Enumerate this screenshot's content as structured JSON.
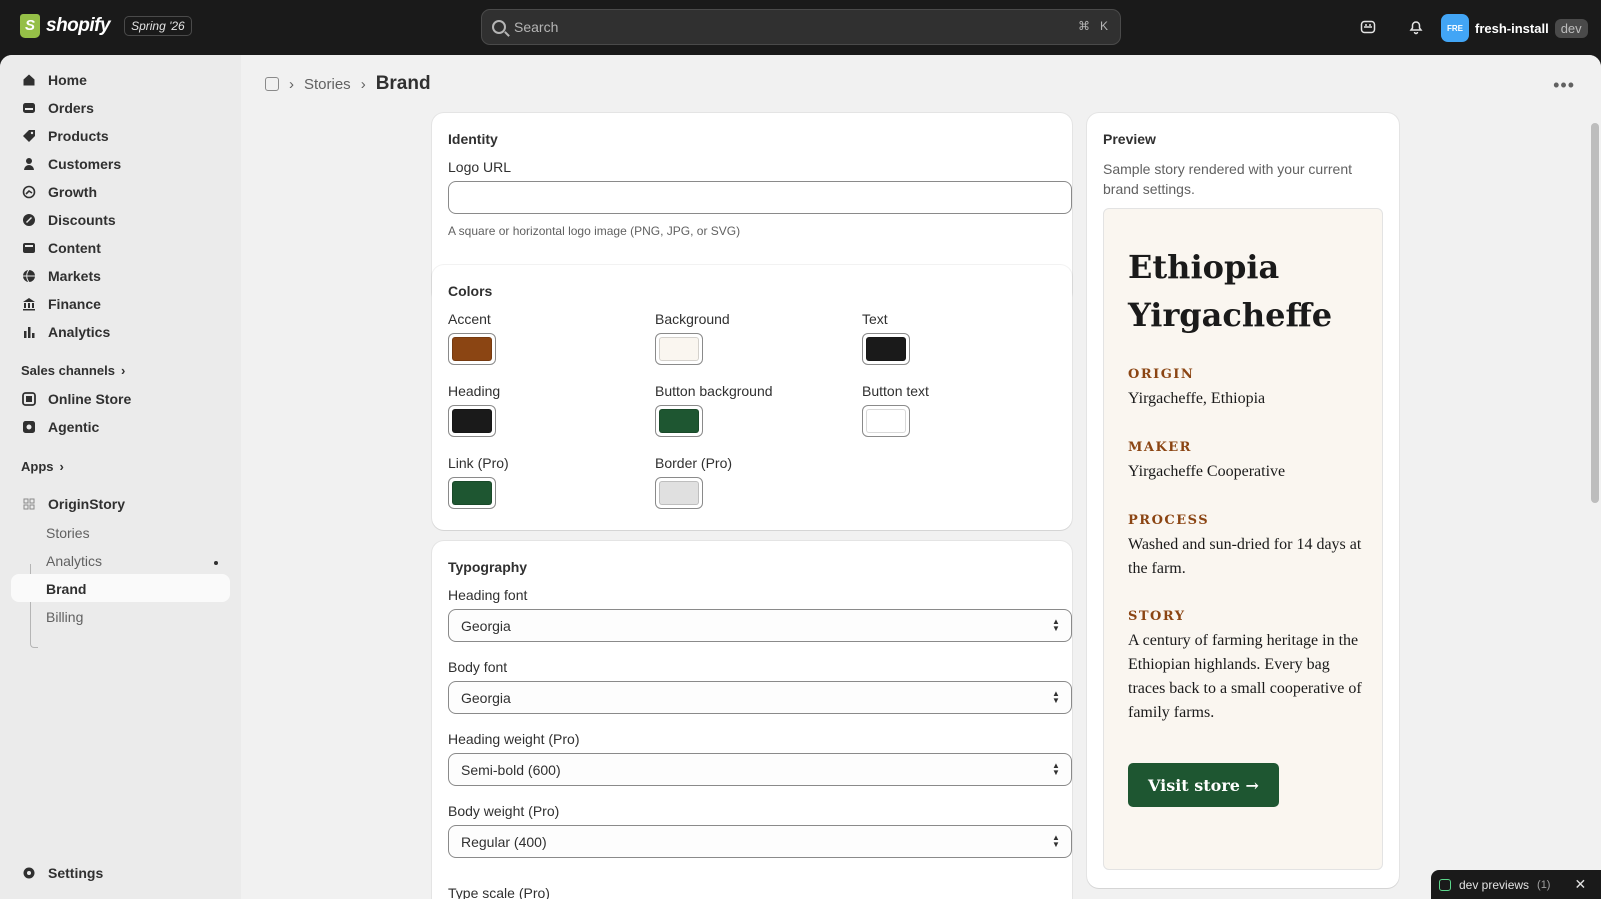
{
  "topbar": {
    "brand": "shopify",
    "edition": "Spring '26",
    "search_placeholder": "Search",
    "shortcut_cmd": "⌘",
    "shortcut_key": "K",
    "avatar_initials": "FRE",
    "store_name": "fresh-install",
    "env_badge": "dev"
  },
  "sidebar": {
    "items": [
      {
        "label": "Home",
        "icon": "home-icon"
      },
      {
        "label": "Orders",
        "icon": "orders-icon"
      },
      {
        "label": "Products",
        "icon": "tag-icon"
      },
      {
        "label": "Customers",
        "icon": "person-icon"
      },
      {
        "label": "Growth",
        "icon": "growth-icon"
      },
      {
        "label": "Discounts",
        "icon": "discount-icon"
      },
      {
        "label": "Content",
        "icon": "content-icon"
      },
      {
        "label": "Markets",
        "icon": "globe-icon"
      },
      {
        "label": "Finance",
        "icon": "bank-icon"
      },
      {
        "label": "Analytics",
        "icon": "chart-icon"
      }
    ],
    "sales_channels_label": "Sales channels",
    "channels": [
      {
        "label": "Online Store",
        "icon": "store-icon"
      },
      {
        "label": "Agentic",
        "icon": "agentic-icon"
      }
    ],
    "apps_label": "Apps",
    "app_name": "OriginStory",
    "app_subitems": [
      "Stories",
      "Analytics",
      "Brand",
      "Billing"
    ],
    "settings_label": "Settings"
  },
  "breadcrumb": {
    "parent": "Stories",
    "current": "Brand"
  },
  "identity": {
    "title": "Identity",
    "logo_label": "Logo URL",
    "logo_value": "",
    "logo_help": "A square or horizontal logo image (PNG, JPG, or SVG)"
  },
  "colors": {
    "title": "Colors",
    "fields": [
      {
        "label": "Accent",
        "color": "#8b4513"
      },
      {
        "label": "Background",
        "color": "#faf6f0"
      },
      {
        "label": "Text",
        "color": "#1a1a1a"
      },
      {
        "label": "Heading",
        "color": "#1a1a1a"
      },
      {
        "label": "Button background",
        "color": "#1e5631"
      },
      {
        "label": "Button text",
        "color": "#ffffff"
      },
      {
        "label": "Link (Pro)",
        "color": "#1e5631"
      },
      {
        "label": "Border (Pro)",
        "color": "#e0e0e0"
      }
    ]
  },
  "typography": {
    "title": "Typography",
    "fields": [
      {
        "label": "Heading font",
        "value": "Georgia"
      },
      {
        "label": "Body font",
        "value": "Georgia"
      },
      {
        "label": "Heading weight (Pro)",
        "value": "Semi-bold (600)"
      },
      {
        "label": "Body weight (Pro)",
        "value": "Regular (400)"
      }
    ],
    "type_scale_label": "Type scale (Pro)"
  },
  "preview": {
    "title": "Preview",
    "subtitle": "Sample story rendered with your current brand settings.",
    "story_title": "Ethiopia Yirgacheffe",
    "sections": [
      {
        "label": "ORIGIN",
        "text": "Yirgacheffe, Ethiopia"
      },
      {
        "label": "MAKER",
        "text": "Yirgacheffe Cooperative"
      },
      {
        "label": "PROCESS",
        "text": "Washed and sun-dried for 14 days at the farm."
      },
      {
        "label": "STORY",
        "text": "A century of farming heritage in the Ethiopian highlands. Every bag traces back to a small cooperative of family farms."
      }
    ],
    "button_label": "Visit store →"
  },
  "toast": {
    "label": "dev previews",
    "count": "(1)"
  }
}
